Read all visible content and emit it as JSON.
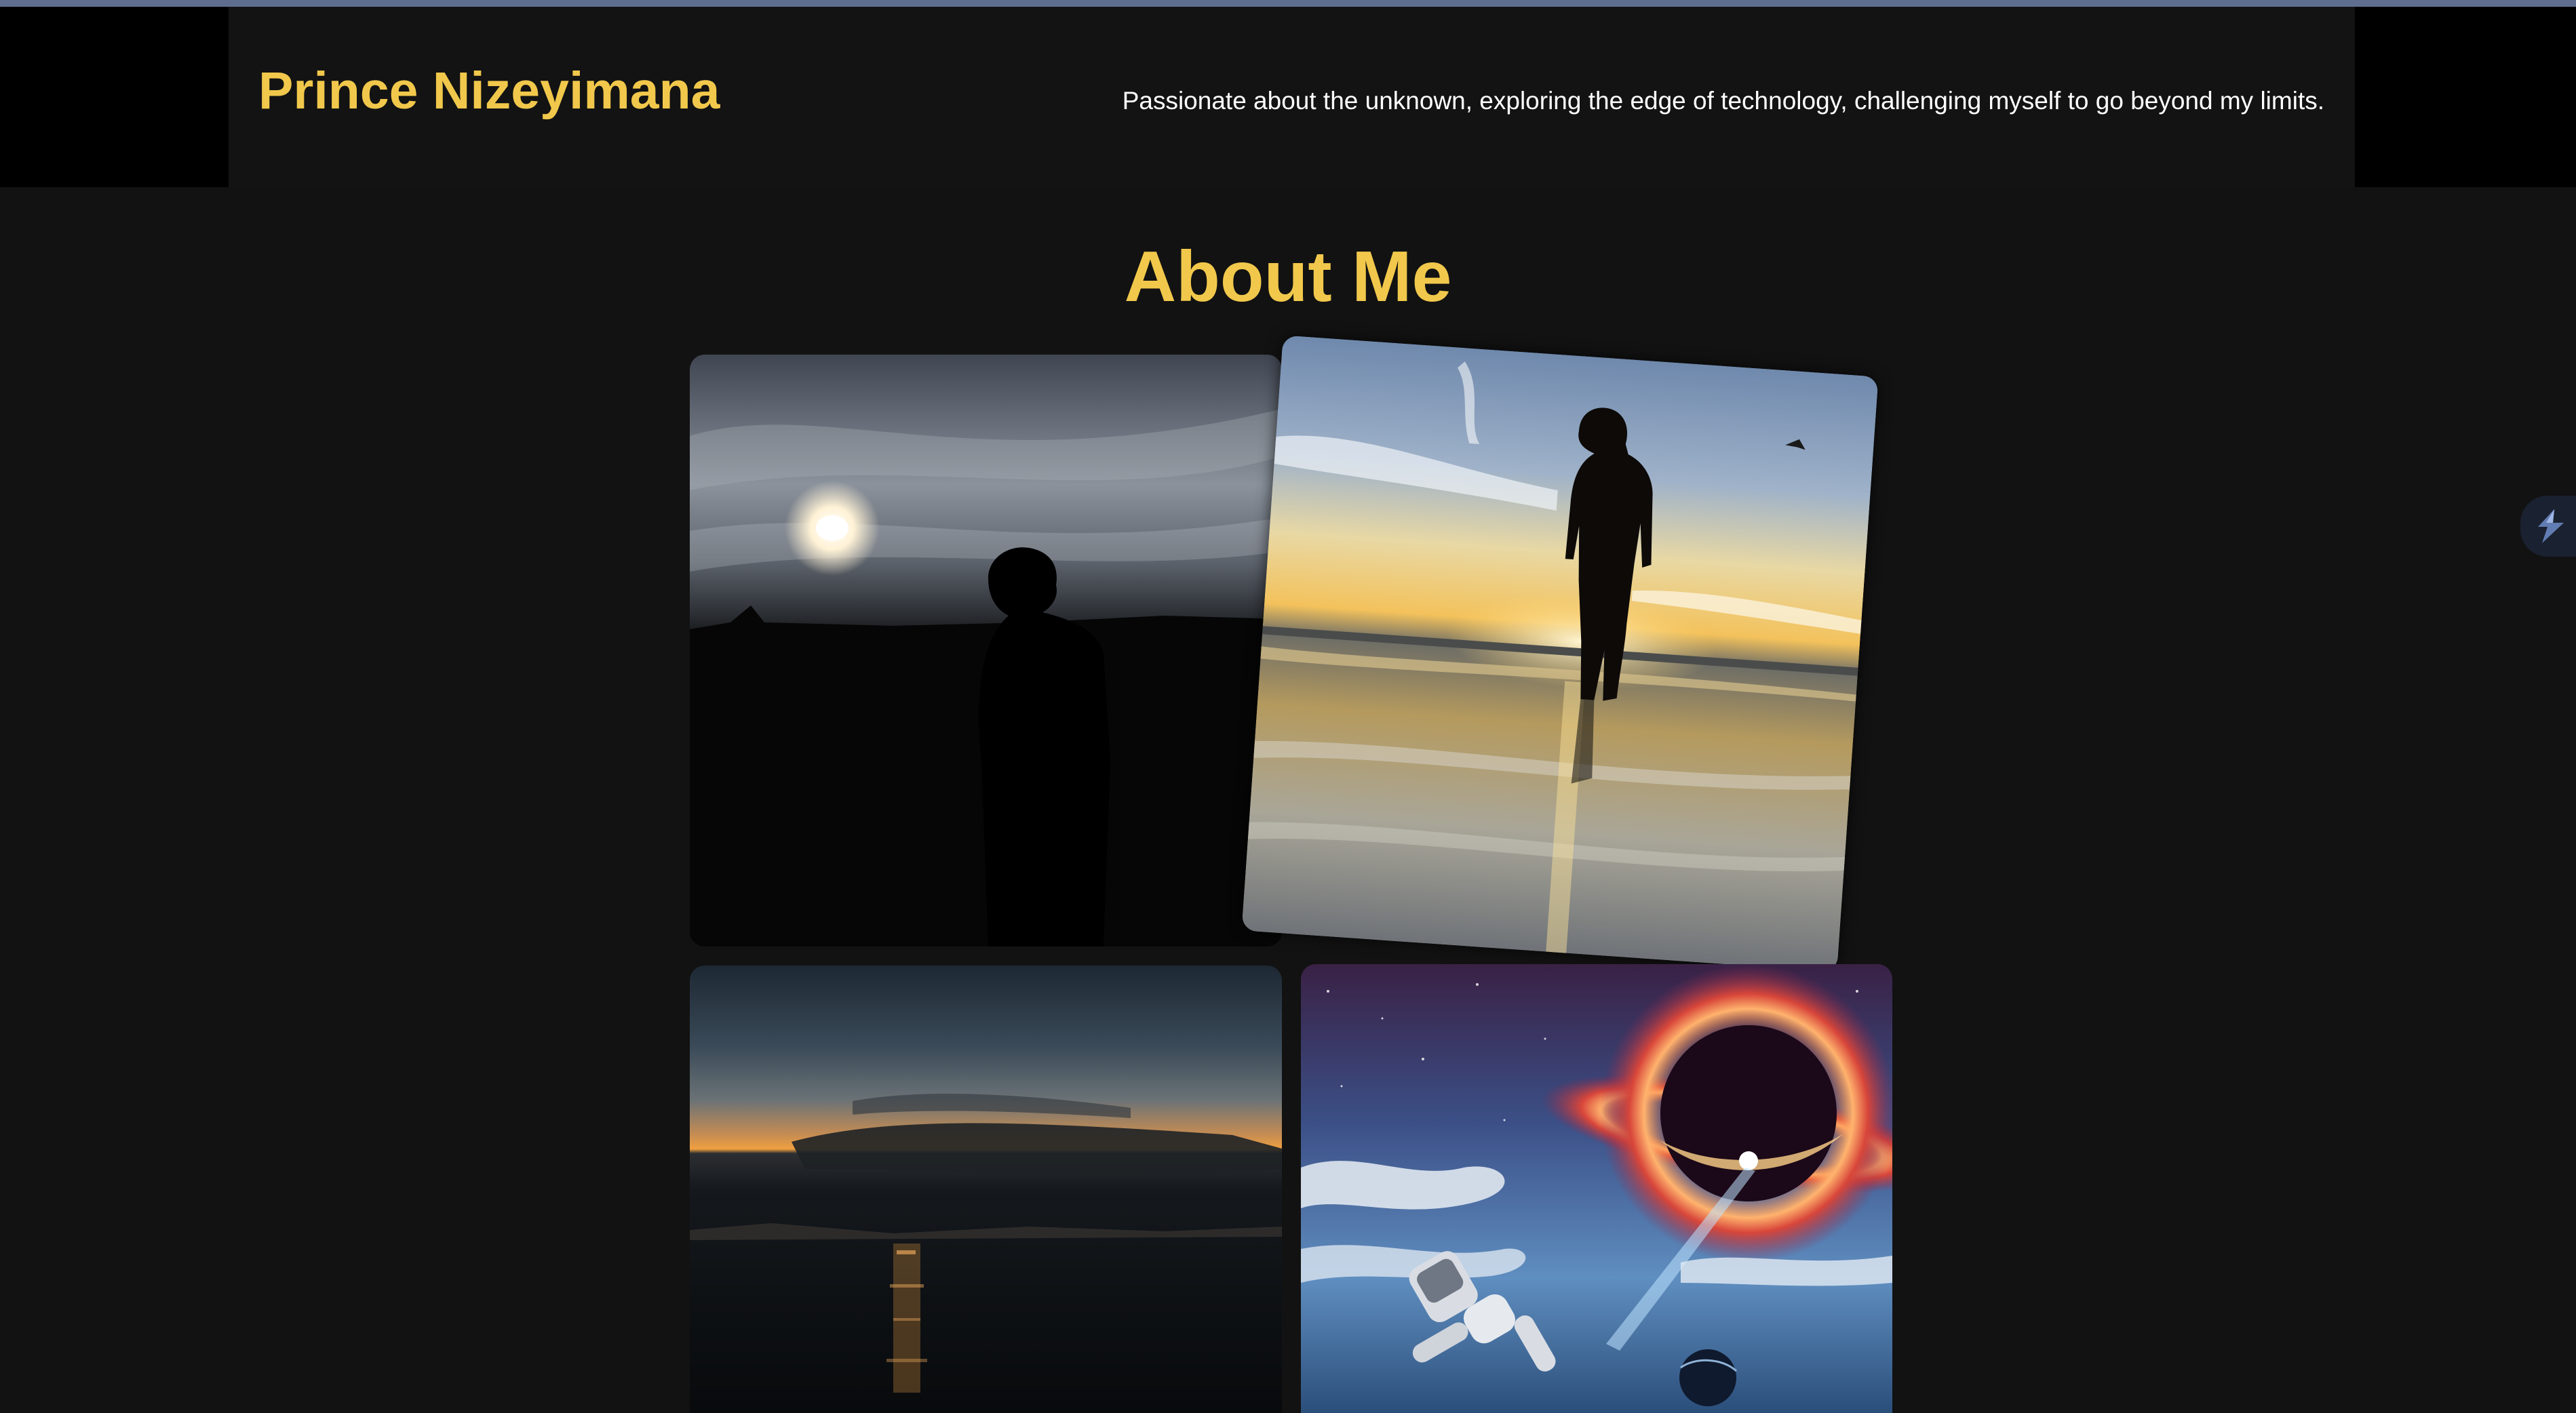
{
  "header": {
    "name": "Prince Nizeyimana",
    "tagline": "Passionate about the unknown, exploring the edge of technology, challenging myself to go beyond my limits."
  },
  "about": {
    "title": "About Me"
  },
  "colors": {
    "accent": "#f1c84b",
    "background": "#121212",
    "header_background": "#131313",
    "text": "#ffffff"
  },
  "gallery": {
    "photos": [
      {
        "subject": "silhouette of a person in a hood against a cloudy sky with the sun"
      },
      {
        "subject": "person in a hoodie walking on a wet beach at sunset"
      },
      {
        "subject": "sunset over the water with dark clouds"
      },
      {
        "subject": "astronaut floating in space near a black hole"
      }
    ]
  },
  "icons": {
    "edge_widget": "assistant-logo-icon"
  }
}
